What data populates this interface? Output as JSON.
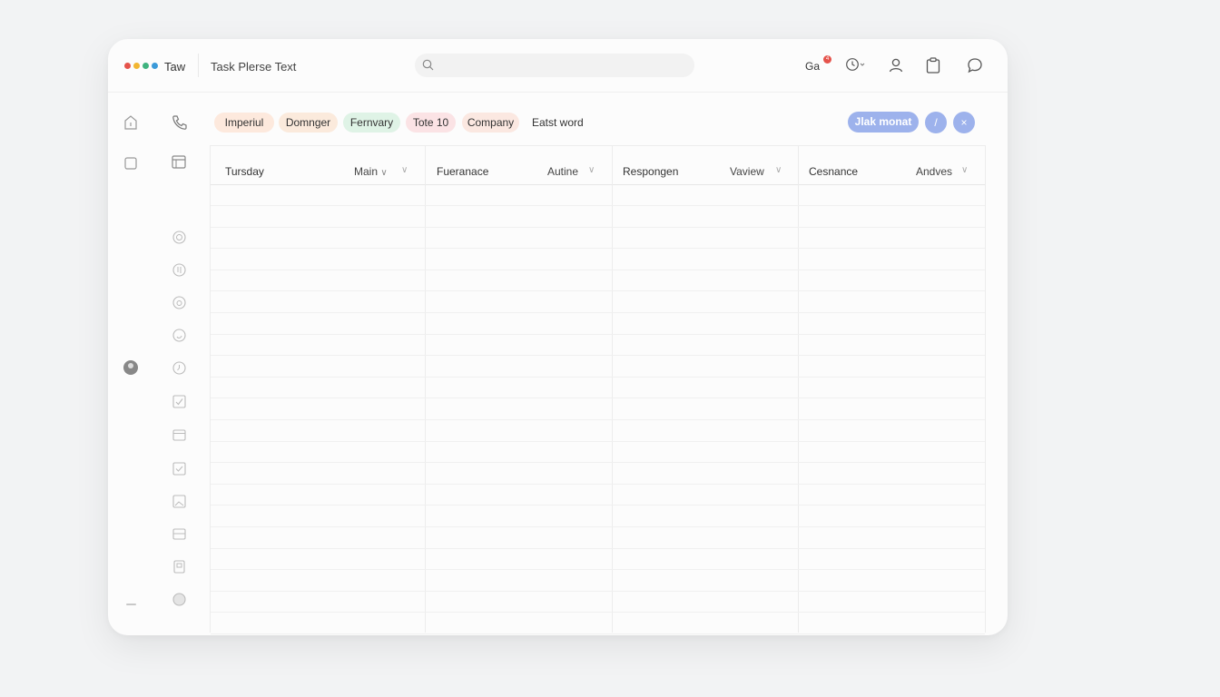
{
  "app": {
    "name": "Taw",
    "title": "Task Plerse Text",
    "dot_colors": [
      "#e5534b",
      "#f2b632",
      "#3fb37f",
      "#3b9ad9"
    ]
  },
  "search": {
    "placeholder": ""
  },
  "header_actions": {
    "notifications_label": "Ga",
    "notifications_badge": "4",
    "icons": [
      "bell-icon",
      "clock-icon",
      "user-icon",
      "clipboard-icon",
      "chat-icon"
    ]
  },
  "filters": {
    "chips": [
      {
        "label": "Imperiul",
        "color": "#fde9dd"
      },
      {
        "label": "Domnger",
        "color": "#fbeadc"
      },
      {
        "label": "Fernvary",
        "color": "#dff3e6"
      },
      {
        "label": "Tote 10",
        "color": "#fbe3e5"
      },
      {
        "label": "Company",
        "color": "#fbe8e1"
      }
    ],
    "plain_label": "Eatst word"
  },
  "toolbar": {
    "primary_label": "Jlak monat",
    "edit_icon": "/",
    "close_icon": "×"
  },
  "table": {
    "columns": [
      {
        "label": "Tursday",
        "sort_label": "Main"
      },
      {
        "label": "Fueranace",
        "sort_label": "Autine"
      },
      {
        "label": "Respongen",
        "sort_label": "Vaview"
      },
      {
        "label": "Cesnance",
        "sort_label": "Andves"
      }
    ]
  },
  "colors": {
    "accent": "#9db2ec",
    "badge": "#e5534b"
  }
}
